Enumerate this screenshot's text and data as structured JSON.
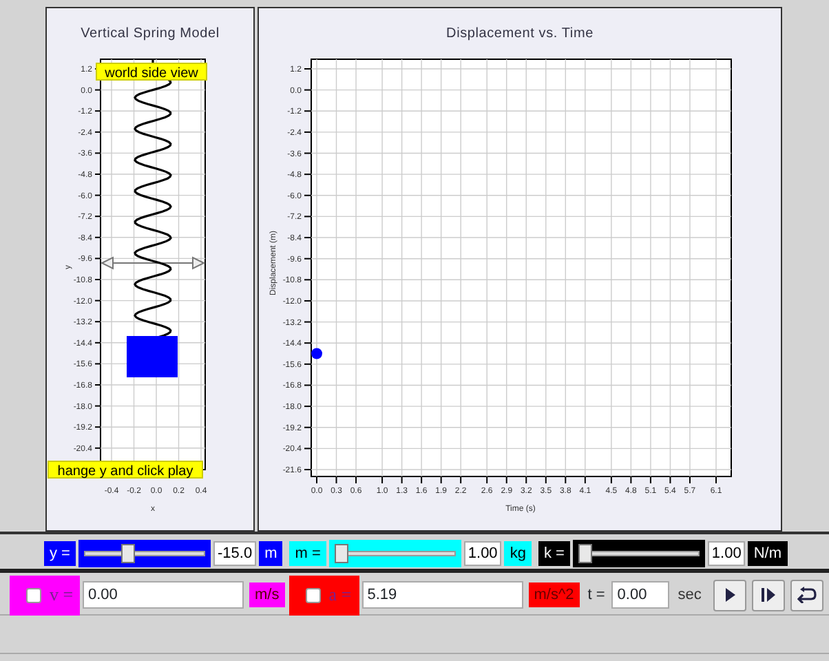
{
  "spring_view": {
    "title": "Vertical Spring Model",
    "yticks": [
      "1.2",
      "0.0",
      "-1.2",
      "-2.4",
      "-3.6",
      "-4.8",
      "-6.0",
      "-7.2",
      "-8.4",
      "-9.6",
      "-10.8",
      "-12.0",
      "-13.2",
      "-14.4",
      "-15.6",
      "-16.8",
      "-18.0",
      "-19.2",
      "-20.4"
    ],
    "xticks": [
      "-0.4",
      "-0.2",
      "0.0",
      "0.2",
      "0.4"
    ],
    "xlabel": "x",
    "ylabel": "y",
    "top_label": "world side view",
    "bottom_label": "hange y and click play"
  },
  "graph": {
    "title": "Displacement vs. Time",
    "chart_data": {
      "type": "scatter",
      "xlabel": "Time (s)",
      "ylabel": "Displacement (m)",
      "x": [
        0
      ],
      "grid": true,
      "series": [
        {
          "color": "#0000ff",
          "values": [
            -15.0
          ]
        }
      ],
      "xlim": [
        0,
        6.1
      ],
      "ylim": [
        -21.6,
        1.2
      ],
      "xticks": [
        {
          "value": 0,
          "label": "0.0"
        },
        0.3,
        0.6,
        {
          "value": 1,
          "label": "1.0"
        },
        1.3,
        1.6,
        1.9,
        2.2,
        2.6,
        2.9,
        3.2,
        3.5,
        3.8,
        4.1,
        4.5,
        4.8,
        5.1,
        5.4,
        5.7,
        6.1
      ],
      "yticks": [
        1.2,
        {
          "value": 0,
          "label": "0.0"
        },
        -1.2,
        -2.4,
        -3.6,
        -4.8,
        {
          "value": -6,
          "label": "-6.0"
        },
        -7.2,
        -8.4,
        -9.6,
        -10.8,
        {
          "value": -12,
          "label": "-12.0"
        },
        -13.2,
        -14.4,
        -15.6,
        -16.8,
        {
          "value": -18,
          "label": "-18.0"
        },
        -19.2,
        -20.4,
        -21.6
      ]
    }
  },
  "sliders": [
    {
      "label": "y =",
      "color": "#0000ff",
      "level": 0.35,
      "value": "-15.0",
      "unit": "m"
    },
    {
      "label": "m =",
      "color": "#00ffff",
      "level": 0.02,
      "value": "1.00",
      "unit": "kg"
    },
    {
      "label": "k =",
      "color": "#000000",
      "level": 0.02,
      "value": "1.00",
      "unit": "N/m"
    }
  ],
  "readouts": [
    {
      "label": "v =",
      "color": "#ff00ff",
      "checked": false,
      "value": "0.00",
      "unit": "m/s"
    },
    {
      "label": "a =",
      "color": "#ff0000",
      "checked": false,
      "value": "5.19",
      "unit": "m/s^2"
    }
  ],
  "time": {
    "label": "t =",
    "value": "0.00",
    "unit": "sec"
  },
  "buttons": [
    {
      "kind": "play"
    },
    {
      "kind": "step"
    },
    {
      "kind": "reset"
    }
  ]
}
